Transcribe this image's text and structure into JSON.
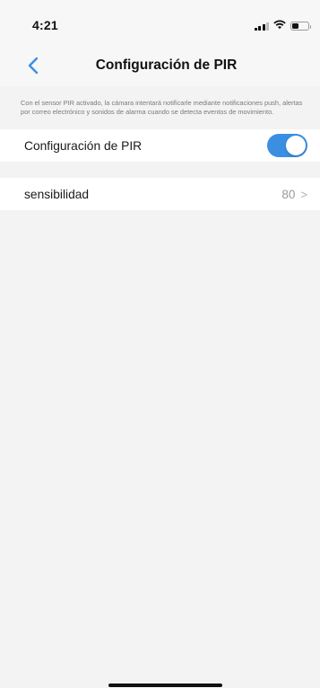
{
  "status_bar": {
    "time": "4:21",
    "icons": [
      "signal-icon",
      "wifi-icon",
      "battery-icon"
    ],
    "battery_level": 0.4
  },
  "nav": {
    "back_icon": "chevron-left-icon",
    "title": "Configuración de PIR"
  },
  "description": {
    "text": "Con el sensor PIR activado, la cámara intentará notificarle mediante notificaciones push, alertas por correo electrónico y sonidos de alarma cuando se detecta eventos de movimiento."
  },
  "settings": {
    "pir": {
      "label": "Configuración de PIR",
      "enabled": true
    },
    "sensitivity": {
      "label": "sensibilidad",
      "value": "80",
      "chevron": ">"
    }
  },
  "colors": {
    "accent": "#3a8fe2",
    "background": "#f3f3f3",
    "row_background": "#ffffff"
  }
}
